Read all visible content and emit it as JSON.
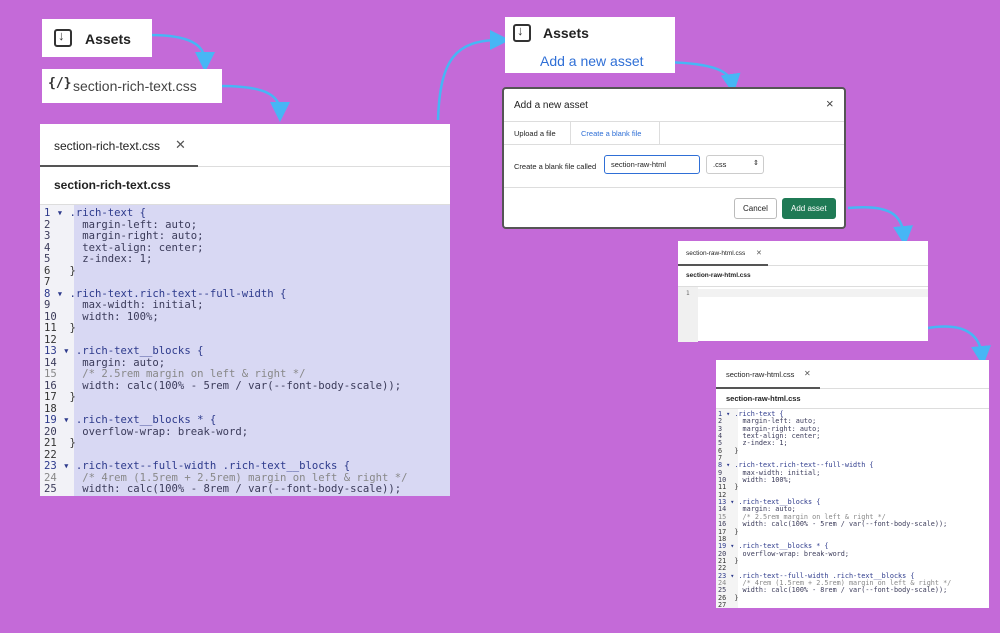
{
  "assets_top": {
    "label": "Assets"
  },
  "file_chip": {
    "icon": "{/}",
    "label": "section-rich-text.css"
  },
  "big_editor": {
    "tab_label": "section-rich-text.css",
    "close_glyph": "✕",
    "file_title": "section-rich-text.css",
    "lines": [
      "1 ▾ .rich-text {",
      "2     margin-left: auto;",
      "3     margin-right: auto;",
      "4     text-align: center;",
      "5     z-index: 1;",
      "6   }",
      "7",
      "8 ▾ .rich-text.rich-text--full-width {",
      "9     max-width: initial;",
      "10    width: 100%;",
      "11  }",
      "12",
      "13 ▾ .rich-text__blocks {",
      "14    margin: auto;",
      "15    /* 2.5rem margin on left & right */",
      "16    width: calc(100% - 5rem / var(--font-body-scale));",
      "17  }",
      "18",
      "19 ▾ .rich-text__blocks * {",
      "20    overflow-wrap: break-word;",
      "21  }",
      "22",
      "23 ▾ .rich-text--full-width .rich-text__blocks {",
      "24    /* 4rem (1.5rem + 2.5rem) margin on left & right */",
      "25    width: calc(100% - 8rem / var(--font-body-scale));"
    ]
  },
  "assets_right": {
    "label": "Assets",
    "add_link": "Add a new asset"
  },
  "dialog": {
    "title": "Add a new asset",
    "close_glyph": "×",
    "tab_upload": "Upload a file",
    "tab_blank": "Create a blank file",
    "field_label": "Create a blank file called",
    "field_value": "section-raw-html",
    "ext_value": ".css",
    "cancel": "Cancel",
    "add": "Add asset"
  },
  "small_editor": {
    "tab_label": "section-raw-html.css",
    "close_glyph": "✕",
    "file_title": "section-raw-html.css",
    "line_no": "1"
  },
  "final_editor": {
    "tab_label": "section-raw-html.css",
    "close_glyph": "✕",
    "file_title": "section-raw-html.css",
    "lines": [
      "1 ▾ .rich-text {",
      "2     margin-left: auto;",
      "3     margin-right: auto;",
      "4     text-align: center;",
      "5     z-index: 1;",
      "6   }",
      "7",
      "8 ▾ .rich-text.rich-text--full-width {",
      "9     max-width: initial;",
      "10    width: 100%;",
      "11  }",
      "12",
      "13 ▾ .rich-text__blocks {",
      "14    margin: auto;",
      "15    /* 2.5rem margin on left & right */",
      "16    width: calc(100% - 5rem / var(--font-body-scale));",
      "17  }",
      "18",
      "19 ▾ .rich-text__blocks * {",
      "20    overflow-wrap: break-word;",
      "21  }",
      "22",
      "23 ▾ .rich-text--full-width .rich-text__blocks {",
      "24    /* 4rem (1.5rem + 2.5rem) margin on left & right */",
      "25    width: calc(100% - 8rem / var(--font-body-scale));",
      "26  }",
      "27"
    ]
  },
  "colors": {
    "background": "#c46ad8",
    "arrow": "#47b6f5",
    "primary_button": "#1f7a55",
    "code_highlight": "#d8d8f3"
  }
}
